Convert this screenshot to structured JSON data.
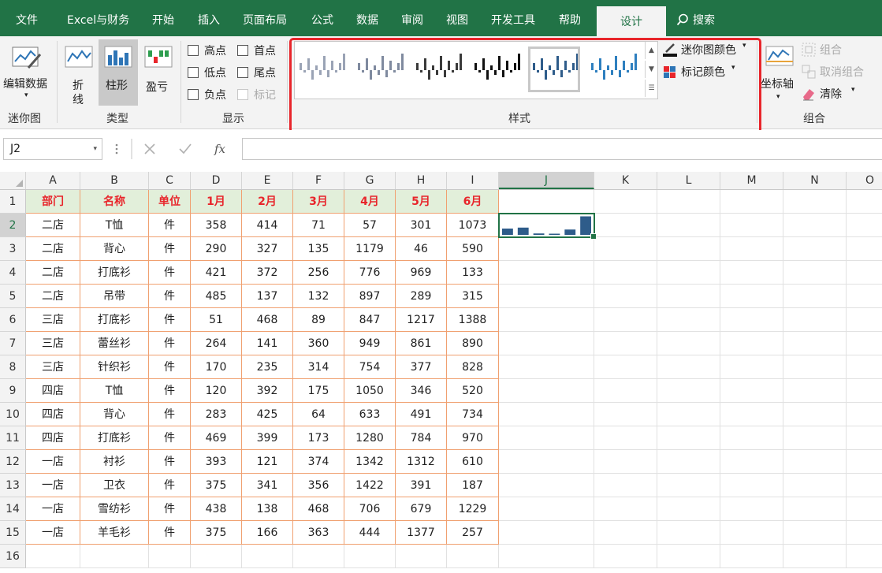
{
  "menu": {
    "items": [
      "文件",
      "Excel与财务",
      "开始",
      "插入",
      "页面布局",
      "公式",
      "数据",
      "审阅",
      "视图",
      "开发工具",
      "帮助"
    ],
    "active_tab": "设计",
    "search": "搜索"
  },
  "ribbon": {
    "sparkline_group": {
      "edit_data": "编辑数据",
      "label": "迷你图"
    },
    "type_group": {
      "line_1": "折",
      "line_2": "线",
      "column": "柱形",
      "winloss": "盈亏",
      "label": "类型"
    },
    "show_group": {
      "high_point": "高点",
      "first_point": "首点",
      "low_point": "低点",
      "last_point": "尾点",
      "negative_point": "负点",
      "markers": "标记",
      "label": "显示"
    },
    "style_group": {
      "label": "样式",
      "selected_index": 4,
      "colors": [
        "#9aa3b5",
        "#7f8a9f",
        "#3a3a3a",
        "#111111",
        "#2e5c8a",
        "#2e7fbf"
      ]
    },
    "color_group": {
      "sparkline_color": "迷你图颜色",
      "marker_color": "标记颜色"
    },
    "group_group": {
      "axis": "坐标轴",
      "group": "组合",
      "ungroup": "取消组合",
      "clear": "清除",
      "label": "组合"
    }
  },
  "formula_bar": {
    "name_box": "J2",
    "formula": ""
  },
  "grid": {
    "columns": [
      "A",
      "B",
      "C",
      "D",
      "E",
      "F",
      "G",
      "H",
      "I",
      "J",
      "K",
      "L",
      "M",
      "N",
      "O"
    ],
    "selected_column": "J",
    "selected_row": 2,
    "headers": [
      "部门",
      "名称",
      "单位",
      "1月",
      "2月",
      "3月",
      "4月",
      "5月",
      "6月"
    ],
    "rows": [
      [
        "二店",
        "T恤",
        "件",
        "358",
        "414",
        "71",
        "57",
        "301",
        "1073"
      ],
      [
        "二店",
        "背心",
        "件",
        "290",
        "327",
        "135",
        "1179",
        "46",
        "590"
      ],
      [
        "二店",
        "打底衫",
        "件",
        "421",
        "372",
        "256",
        "776",
        "969",
        "133"
      ],
      [
        "二店",
        "吊带",
        "件",
        "485",
        "137",
        "132",
        "897",
        "289",
        "315"
      ],
      [
        "三店",
        "打底衫",
        "件",
        "51",
        "468",
        "89",
        "847",
        "1217",
        "1388"
      ],
      [
        "三店",
        "蕾丝衫",
        "件",
        "264",
        "141",
        "360",
        "949",
        "861",
        "890"
      ],
      [
        "三店",
        "针织衫",
        "件",
        "170",
        "235",
        "314",
        "754",
        "377",
        "828"
      ],
      [
        "四店",
        "T恤",
        "件",
        "120",
        "392",
        "175",
        "1050",
        "346",
        "520"
      ],
      [
        "四店",
        "背心",
        "件",
        "283",
        "425",
        "64",
        "633",
        "491",
        "734"
      ],
      [
        "四店",
        "打底衫",
        "件",
        "469",
        "399",
        "173",
        "1280",
        "784",
        "970"
      ],
      [
        "一店",
        "衬衫",
        "件",
        "393",
        "121",
        "374",
        "1342",
        "1312",
        "610"
      ],
      [
        "一店",
        "卫衣",
        "件",
        "375",
        "341",
        "356",
        "1422",
        "391",
        "187"
      ],
      [
        "一店",
        "雪纺衫",
        "件",
        "438",
        "138",
        "468",
        "706",
        "679",
        "1229"
      ],
      [
        "一店",
        "羊毛衫",
        "件",
        "375",
        "166",
        "363",
        "444",
        "1377",
        "257"
      ]
    ],
    "row_numbers": [
      "1",
      "2",
      "3",
      "4",
      "5",
      "6",
      "7",
      "8",
      "9",
      "10",
      "11",
      "12",
      "13",
      "14",
      "15",
      "16"
    ],
    "sparkline": {
      "values": [
        358,
        414,
        71,
        57,
        301,
        1073
      ],
      "color": "#2e5c8a"
    }
  },
  "colors": {
    "brand": "#217346",
    "header_fill": "#e2efda",
    "header_text": "#e8252b",
    "table_border": "#f0a070",
    "highlight": "#e8252b"
  }
}
